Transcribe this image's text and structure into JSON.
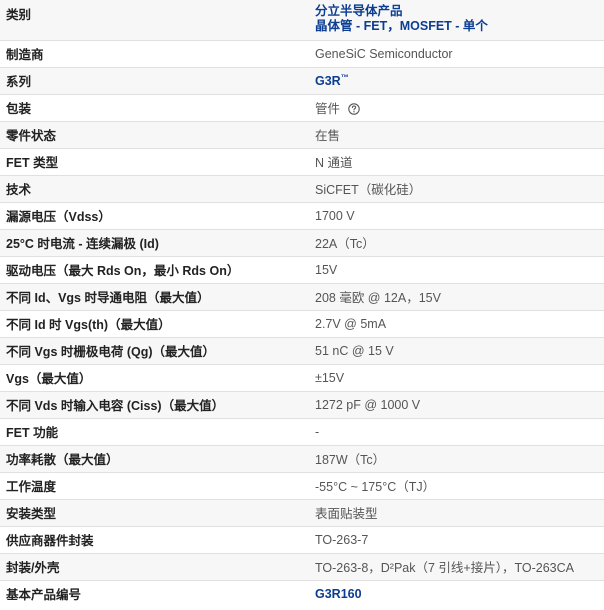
{
  "rows": [
    {
      "label": "类别",
      "values": [
        "分立半导体产品",
        "晶体管 - FET，MOSFET - 单个"
      ]
    },
    {
      "label": "制造商",
      "value": "GeneSiC Semiconductor"
    },
    {
      "label": "系列",
      "value": "G3R",
      "trademark": "™"
    },
    {
      "label": "包装",
      "value": "管件",
      "icon": "help-circle-icon"
    },
    {
      "label": "零件状态",
      "value": "在售"
    },
    {
      "label": "FET 类型",
      "value": "N 通道"
    },
    {
      "label": "技术",
      "value": "SiCFET（碳化硅）"
    },
    {
      "label": "漏源电压（Vdss）",
      "value": "1700 V"
    },
    {
      "label": "25°C 时电流 - 连续漏极 (Id)",
      "value": "22A（Tc）"
    },
    {
      "label": "驱动电压（最大 Rds On，最小 Rds On）",
      "value": "15V"
    },
    {
      "label": "不同 Id、Vgs 时导通电阻（最大值）",
      "value": "208 毫欧 @ 12A，15V"
    },
    {
      "label": "不同 Id 时 Vgs(th)（最大值）",
      "value": "2.7V @ 5mA"
    },
    {
      "label": "不同 Vgs 时栅极电荷 (Qg)（最大值）",
      "value": "51 nC @ 15 V"
    },
    {
      "label": "Vgs（最大值）",
      "value": "±15V"
    },
    {
      "label": "不同 Vds 时输入电容 (Ciss)（最大值）",
      "value": "1272 pF @ 1000 V"
    },
    {
      "label": "FET 功能",
      "value": "-"
    },
    {
      "label": "功率耗散（最大值）",
      "value": "187W（Tc）"
    },
    {
      "label": "工作温度",
      "value": "-55°C ~ 175°C（TJ）"
    },
    {
      "label": "安装类型",
      "value": "表面贴装型"
    },
    {
      "label": "供应商器件封装",
      "value": "TO-263-7"
    },
    {
      "label": "封装/外壳",
      "value": "TO-263-8，D²Pak（7 引线+接片），TO-263CA"
    },
    {
      "label": "基本产品编号",
      "value": "G3R160"
    }
  ],
  "colors": {
    "link": "#0b3d91",
    "stripe": "#f7f7f7",
    "border": "#e0e0e0"
  }
}
